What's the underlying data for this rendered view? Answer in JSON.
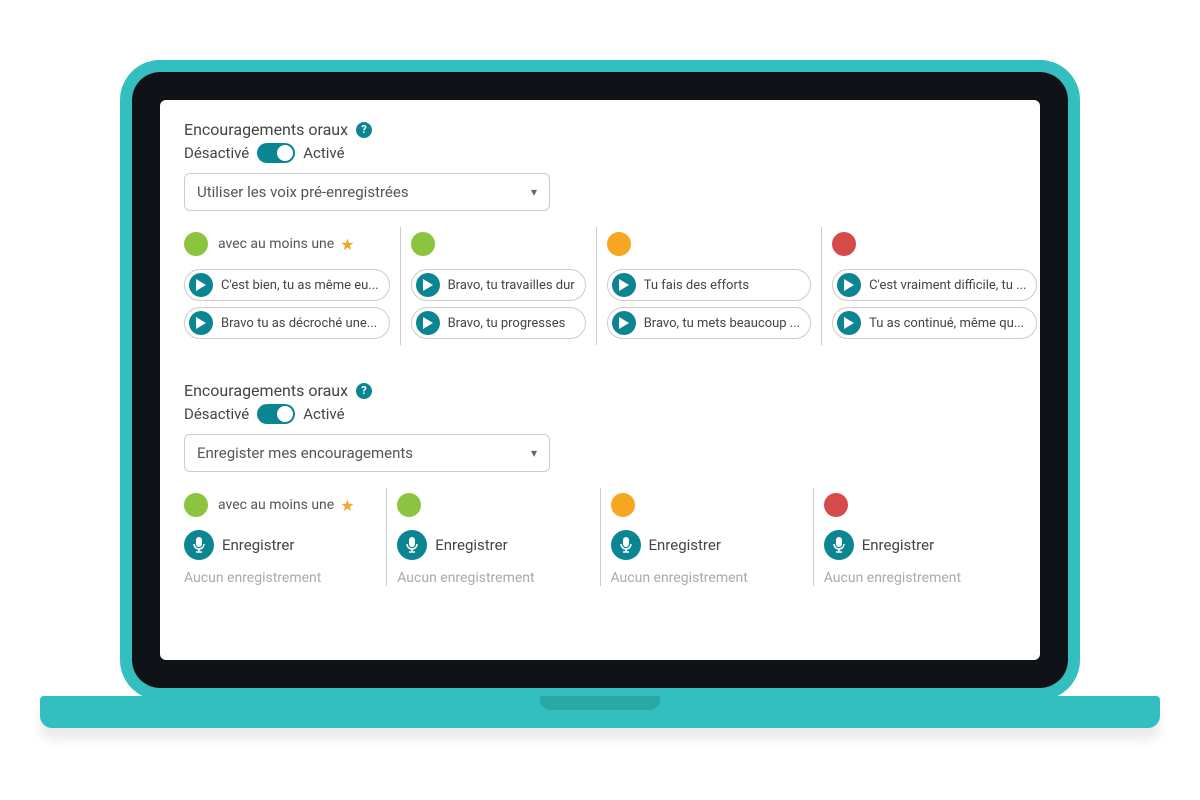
{
  "colors": {
    "accent": "#33bfbf",
    "teal_dark": "#0c8592",
    "green": "#8bc53f",
    "orange": "#f5a623",
    "red": "#d64a4a"
  },
  "section1": {
    "title": "Encouragements oraux",
    "help": "?",
    "toggle_off": "Désactivé",
    "toggle_on": "Activé",
    "select_value": "Utiliser les voix pré-enregistrées",
    "star_label": "avec au moins une",
    "cols": [
      {
        "color": "green",
        "has_star": true,
        "items": [
          "C'est bien, tu as même eu...",
          "Bravo tu as décroché une..."
        ]
      },
      {
        "color": "green",
        "has_star": false,
        "items": [
          "Bravo, tu travailles dur",
          "Bravo, tu progresses"
        ]
      },
      {
        "color": "orange",
        "has_star": false,
        "items": [
          "Tu fais des efforts",
          "Bravo, tu mets beaucoup ..."
        ]
      },
      {
        "color": "red",
        "has_star": false,
        "items": [
          "C'est vraiment difficile, tu ...",
          "Tu as continué, même qu..."
        ]
      }
    ]
  },
  "section2": {
    "title": "Encouragements oraux",
    "help": "?",
    "toggle_off": "Désactivé",
    "toggle_on": "Activé",
    "select_value": "Enregister mes encouragements",
    "star_label": "avec au moins une",
    "record_label": "Enregistrer",
    "empty": "Aucun enregistrement",
    "cols": [
      {
        "color": "green",
        "has_star": true
      },
      {
        "color": "green",
        "has_star": false
      },
      {
        "color": "orange",
        "has_star": false
      },
      {
        "color": "red",
        "has_star": false
      }
    ]
  }
}
